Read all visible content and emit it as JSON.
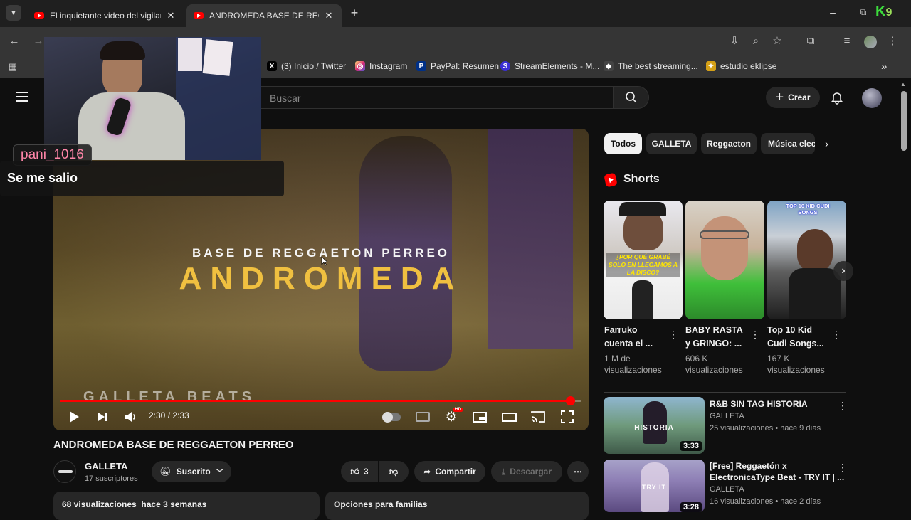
{
  "browser": {
    "tabs": [
      {
        "title": "El inquietante video del vigilant",
        "active": false
      },
      {
        "title": "ANDROMEDA BASE DE REGGAETON PERREO - YouTube",
        "active": true
      }
    ],
    "new_tab": "+",
    "window": {
      "minimize": "–",
      "restore": "⧉",
      "close": "✕"
    },
    "bookmarks": [
      {
        "label": "(3) Inicio / Twitter",
        "icon": "x-twitter-icon",
        "color": "#000000"
      },
      {
        "label": "Instagram",
        "icon": "instagram-icon",
        "color": "#d6249f"
      },
      {
        "label": "PayPal: Resumen",
        "icon": "paypal-icon",
        "color": "#003087"
      },
      {
        "label": "StreamElements - M...",
        "icon": "streamelements-icon",
        "color": "#3b2fd6"
      },
      {
        "label": "The best streaming...",
        "icon": "streaming-icon",
        "color": "#444444"
      },
      {
        "label": "estudio eklipse",
        "icon": "eklipse-icon",
        "color": "#d4a017"
      }
    ],
    "bookmarks_more": "»"
  },
  "youtube": {
    "search_placeholder": "Buscar",
    "create_label": "Crear",
    "chips": [
      "Todos",
      "GALLETA",
      "Reggaeton",
      "Música elec"
    ],
    "shorts_heading": "Shorts",
    "shorts": [
      {
        "title": "Farruko\ncuenta el ...",
        "views": "1 M de\nvisualizaciones",
        "caption": "¿POR QUÉ GRABÉ SOLO EN LLEGAMOS A LA DISCO?"
      },
      {
        "title": "BABY RASTA\ny GRINGO: ...",
        "views": "606 K\nvisualizaciones",
        "caption": ""
      },
      {
        "title": "Top 10 Kid\nCudi Songs...",
        "views": "167 K\nvisualizaciones",
        "caption": "TOP 10 KID CUDI SONGS"
      }
    ],
    "related": [
      {
        "title": "R&B SIN TAG HISTORIA",
        "channel": "GALLETA",
        "meta": "25 visualizaciones • hace 9 días",
        "duration": "3:33",
        "thumb_text": "HISTORIA"
      },
      {
        "title": "[Free] Reggaetón x\nElectronicaType Beat - TRY IT | ...",
        "channel": "GALLETA",
        "meta": "16 visualizaciones • hace 2 días",
        "duration": "3:28",
        "thumb_text": "TRY IT"
      }
    ],
    "video": {
      "title": "ANDROMEDA BASE DE REGGAETON PERREO",
      "thumb_subtitle": "BASE DE REGGAETON PERREO",
      "thumb_title": "ANDROMEDA",
      "watermark": "GALLETA BEATS",
      "time": "2:30 / 2:33",
      "progress": 0.978,
      "channel": "GALLETA",
      "subscribers": "17 suscriptores",
      "subscribe_state": "Suscrito",
      "likes": "3",
      "share": "Compartir",
      "download": "Descargar",
      "views": "68 visualizaciones",
      "uploaded": "hace 3 semanas",
      "family": "Opciones para familias"
    }
  },
  "overlay": {
    "username": "pani_1016",
    "message": "Se me salio"
  },
  "colors": {
    "accent": "#ff0000",
    "username": "#ff85a8",
    "title_yellow": "#f0c040"
  }
}
